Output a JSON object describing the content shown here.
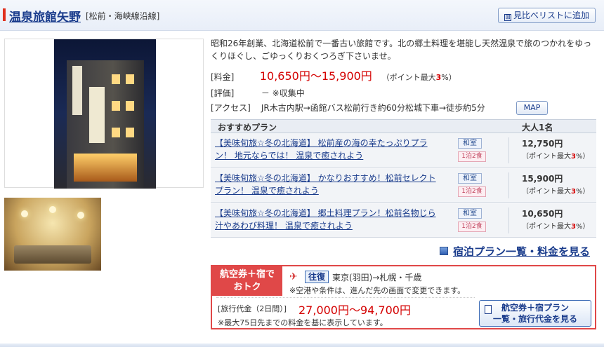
{
  "header": {
    "hotel_name": "温泉旅館矢野",
    "area": "[松前・海峡線沿線]",
    "compare_icon": "⊞",
    "compare_label": "見比べリストに追加"
  },
  "description": "昭和26年創業、北海道松前で一番古い旅館です。北の郷土料理を堪能し天然温泉で旅のつかれをゆっくりほぐし、ごゆっくりおくつろぎ下さいませ。",
  "price": {
    "label": "[料金]",
    "value": "10,650円～15,900円",
    "point_prefix": "（ポイント最大",
    "point_rate": "3",
    "point_suffix": "%）"
  },
  "rating": {
    "label": "[評価]",
    "value": "－ ※収集中"
  },
  "access": {
    "label": "[アクセス]",
    "value": "JR木古内駅→函館バス松前行き約60分松城下車→徒歩約5分",
    "map_label": "MAP"
  },
  "plans": {
    "header_plan": "おすすめプラン",
    "header_price": "大人1名",
    "items": [
      {
        "title": "【美味旬旅☆冬の北海道】 松前産の海の幸たっぷりプラン！ 地元ならでは！ 温泉で癒されよう",
        "room": "和室",
        "meal": "1泊2食",
        "price": "12,750円",
        "point_prefix": "（ポイント最大",
        "point_rate": "3",
        "point_suffix": "%）"
      },
      {
        "title": "【美味旬旅☆冬の北海道】 かなりおすすめ！松前セレクトプラン！ 温泉で癒されよう",
        "room": "和室",
        "meal": "1泊2食",
        "price": "15,900円",
        "point_prefix": "（ポイント最大",
        "point_rate": "3",
        "point_suffix": "%）"
      },
      {
        "title": "【美味旬旅☆冬の北海道】 郷土料理プラン！松前名物じら汁やあわび料理！ 温泉で癒されよう",
        "room": "和室",
        "meal": "1泊2食",
        "price": "10,650円",
        "point_prefix": "（ポイント最大",
        "point_rate": "3",
        "point_suffix": "%）"
      }
    ],
    "all_link": "宿泊プラン一覧・料金を見る"
  },
  "air": {
    "badge_line1": "航空券＋宿で",
    "badge_line2": "おトク",
    "trip_type": "往復",
    "route": "東京(羽田)→札幌・千歳",
    "note1": "※空港や条件は、進んだ先の画面で変更できます。",
    "fare_label": "[旅行代金（2日間）]",
    "fare": "27,000円～94,700円",
    "note2": "※最大75日先までの料金を基に表示しています。",
    "button_line1": "航空券＋宿プラン",
    "button_line2": "一覧・旅行代金を見る"
  },
  "colors": {
    "accent": "#e0301e",
    "link": "#1a3c8c",
    "price": "#d40000",
    "air_border": "#e04848"
  }
}
